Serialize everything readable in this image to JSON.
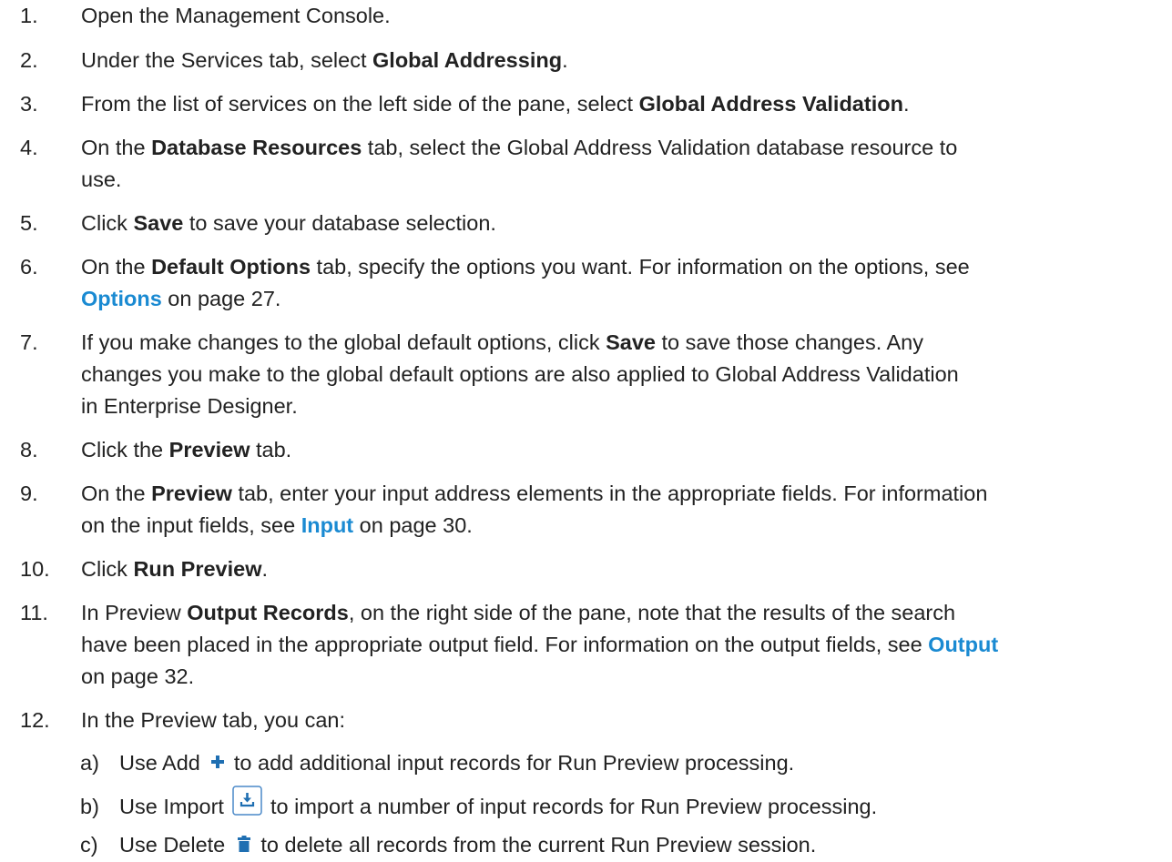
{
  "steps": [
    {
      "num": "1.",
      "parts": [
        {
          "t": "Open the Management Console."
        }
      ]
    },
    {
      "num": "2.",
      "parts": [
        {
          "t": "Under the Services tab, select "
        },
        {
          "t": "Global Addressing",
          "b": true
        },
        {
          "t": "."
        }
      ]
    },
    {
      "num": "3.",
      "parts": [
        {
          "t": "From the list of services on the left side of the pane, select "
        },
        {
          "t": "Global Address Validation",
          "b": true
        },
        {
          "t": "."
        }
      ]
    },
    {
      "num": "4.",
      "parts": [
        {
          "t": "On the "
        },
        {
          "t": "Database Resources",
          "b": true
        },
        {
          "t": " tab, select the Global Address Validation database resource to"
        }
      ],
      "cont": [
        [
          {
            "t": "use."
          }
        ]
      ]
    },
    {
      "num": "5.",
      "parts": [
        {
          "t": "Click "
        },
        {
          "t": "Save",
          "b": true
        },
        {
          "t": " to save your database selection."
        }
      ]
    },
    {
      "num": "6.",
      "parts": [
        {
          "t": "On the "
        },
        {
          "t": "Default Options",
          "b": true
        },
        {
          "t": " tab, specify the options you want. For information on the options, see"
        }
      ],
      "cont": [
        [
          {
            "t": "Options",
            "link": true
          },
          {
            "t": " on page 27."
          }
        ]
      ]
    },
    {
      "num": "7.",
      "parts": [
        {
          "t": "If you make changes to the global default options, click "
        },
        {
          "t": "Save",
          "b": true
        },
        {
          "t": " to save those changes. Any"
        }
      ],
      "cont": [
        [
          {
            "t": "changes you make to the global default options are also applied to Global Address Validation"
          }
        ],
        [
          {
            "t": "in Enterprise Designer."
          }
        ]
      ]
    },
    {
      "num": "8.",
      "parts": [
        {
          "t": "Click the "
        },
        {
          "t": "Preview",
          "b": true
        },
        {
          "t": " tab."
        }
      ]
    },
    {
      "num": "9.",
      "parts": [
        {
          "t": "On the "
        },
        {
          "t": "Preview",
          "b": true
        },
        {
          "t": " tab, enter your input address elements in the appropriate fields. For information"
        }
      ],
      "cont": [
        [
          {
            "t": "on the input fields, see "
          },
          {
            "t": "Input",
            "link": true
          },
          {
            "t": " on page 30."
          }
        ]
      ]
    },
    {
      "num": "10.",
      "parts": [
        {
          "t": "Click "
        },
        {
          "t": "Run Preview",
          "b": true
        },
        {
          "t": "."
        }
      ]
    },
    {
      "num": "11.",
      "parts": [
        {
          "t": "In Preview "
        },
        {
          "t": "Output Records",
          "b": true
        },
        {
          "t": ", on the right side of the pane, note that the results of the search"
        }
      ],
      "cont": [
        [
          {
            "t": "have been placed in the appropriate output field. For information on the output fields, see "
          },
          {
            "t": "Output",
            "link": true
          }
        ],
        [
          {
            "t": "on page 32."
          }
        ]
      ]
    },
    {
      "num": "12.",
      "parts": [
        {
          "t": "In the Preview tab, you can:"
        }
      ]
    }
  ],
  "substeps": [
    {
      "num": "a)",
      "before": "Use Add",
      "icon": "plus-icon",
      "after": "to add additional input records for Run Preview processing."
    },
    {
      "num": "b)",
      "before": "Use Import",
      "icon": "import-icon",
      "after": "to import a number of input records for Run Preview processing."
    },
    {
      "num": "c)",
      "before": "Use Delete",
      "icon": "trash-icon",
      "after": "to delete all records from the current Run Preview session."
    }
  ],
  "colors": {
    "text": "#222222",
    "link": "#1a8ad2",
    "icon_blue": "#1f6fb2"
  }
}
